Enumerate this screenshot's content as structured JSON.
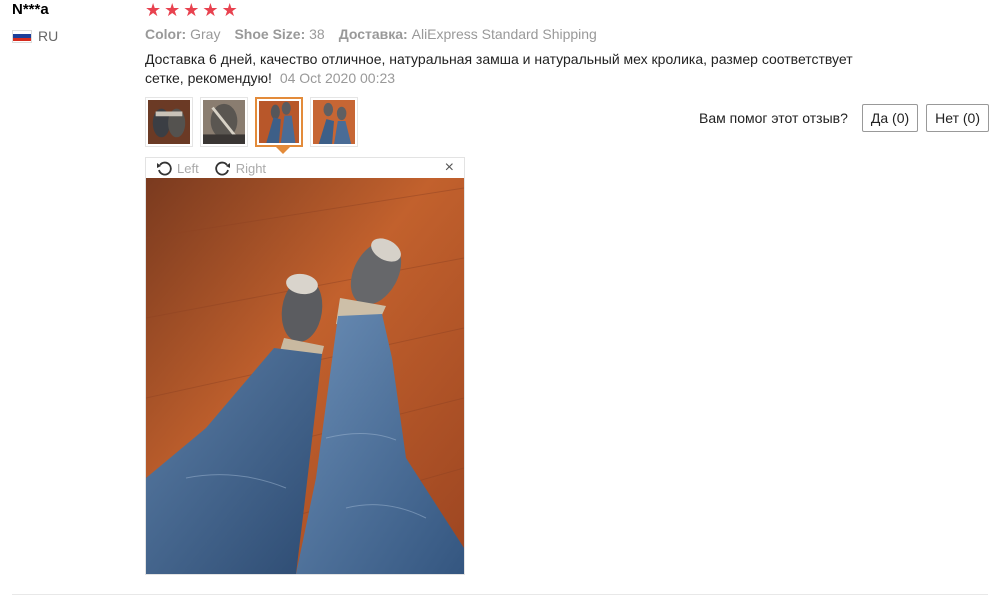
{
  "review": {
    "user_name": "N***a",
    "country_code": "RU",
    "rating": 5,
    "attributes": [
      {
        "key": "Color:",
        "value": "Gray"
      },
      {
        "key": "Shoe Size:",
        "value": "38"
      },
      {
        "key": "Доставка:",
        "value": "AliExpress Standard Shipping"
      }
    ],
    "text": "Доставка 6 дней, качество отличное, натуральная замша и натуральный мех кролика, размер соответствует сетке, рекомендую!",
    "date": "04 Oct 2020 00:23"
  },
  "helpful": {
    "question": "Вам помог этот отзыв?",
    "yes_label": "Да (0)",
    "no_label": "Нет (0)"
  },
  "viewer": {
    "rotate_left_label": "Left",
    "rotate_right_label": "Right",
    "close_symbol": "×"
  },
  "icons": {
    "star": "star-icon",
    "flag": "russia-flag-icon",
    "rotate_left": "rotate-left-icon",
    "rotate_right": "rotate-right-icon",
    "close": "close-icon"
  },
  "colors": {
    "star": "#e8424f",
    "active_thumb_border": "#e38b3a",
    "floor": "#b8572a",
    "jeans": "#3d5f88"
  }
}
